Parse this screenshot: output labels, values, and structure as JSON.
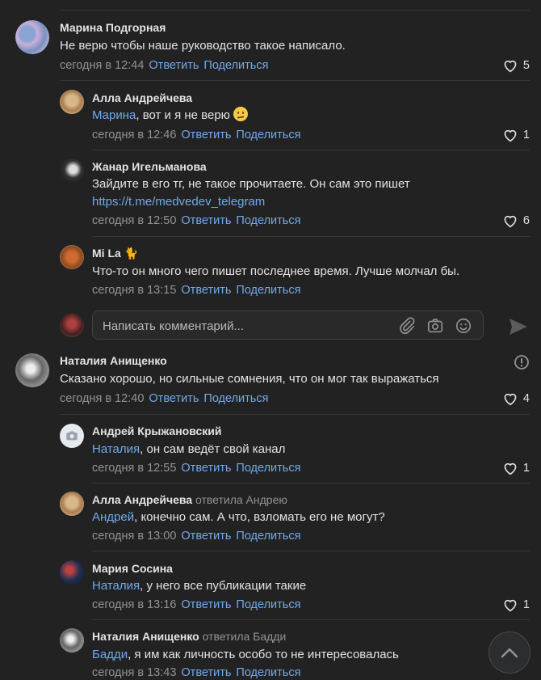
{
  "comments": [
    {
      "author": "Марина Подгорная",
      "replied": "",
      "text_link": "",
      "text": "Не верю чтобы наше руководство такое написало.",
      "url": "",
      "time": "сегодня в 12:44",
      "reply": "Ответить",
      "share": "Поделиться",
      "likes": "5"
    },
    {
      "author": "Алла Андрейчева",
      "replied": "",
      "text_link": "Марина",
      "text": ", вот и я не верю",
      "url": "",
      "time": "сегодня в 12:46",
      "reply": "Ответить",
      "share": "Поделиться",
      "likes": "1"
    },
    {
      "author": "Жанар Игельманова",
      "replied": "",
      "text_link": "",
      "text": "Зайдите в его тг, не такое прочитаете. Он сам это пишет",
      "url": "https://t.me/medvedev_telegram",
      "time": "сегодня в 12:50",
      "reply": "Ответить",
      "share": "Поделиться",
      "likes": "6"
    },
    {
      "author": "Mi La 🐈",
      "replied": "",
      "text_link": "",
      "text": "Что-то он много чего пишет последнее время. Лучше молчал бы.",
      "url": "",
      "time": "сегодня в 13:15",
      "reply": "Ответить",
      "share": "Поделиться",
      "likes": ""
    },
    {
      "author": "Наталия Анищенко",
      "replied": "",
      "text_link": "",
      "text": "Сказано хорошо, но сильные сомнения, что он мог так выражаться",
      "url": "",
      "time": "сегодня в 12:40",
      "reply": "Ответить",
      "share": "Поделиться",
      "likes": "4"
    },
    {
      "author": "Андрей Крыжановский",
      "replied": "",
      "text_link": "Наталия",
      "text": ", он сам ведёт свой канал",
      "url": "",
      "time": "сегодня в 12:55",
      "reply": "Ответить",
      "share": "Поделиться",
      "likes": "1"
    },
    {
      "author": "Алла Андрейчева",
      "replied": "ответила Андрею",
      "text_link": "Андрей",
      "text": ", конечно сам. А что, взломать его не могут?",
      "url": "",
      "time": "сегодня в 13:00",
      "reply": "Ответить",
      "share": "Поделиться",
      "likes": ""
    },
    {
      "author": "Мария Сосина",
      "replied": "",
      "text_link": "Наталия",
      "text": ", у него все публикации такие",
      "url": "",
      "time": "сегодня в 13:16",
      "reply": "Ответить",
      "share": "Поделиться",
      "likes": "1"
    },
    {
      "author": "Наталия Анищенко",
      "replied": "ответила Бадди",
      "text_link": "Бадди",
      "text": ", я им как личность особо то не интересовалась",
      "url": "",
      "time": "сегодня в 13:43",
      "reply": "Ответить",
      "share": "Поделиться",
      "likes": ""
    }
  ],
  "composer": {
    "placeholder": "Написать комментарий..."
  },
  "icons": {
    "attach": "paperclip-icon",
    "camera": "camera-icon",
    "emoji": "smile-icon",
    "send": "send-icon",
    "like": "heart-icon",
    "info": "info-icon",
    "scroll_up": "chevron-up-icon"
  },
  "colors": {
    "background": "#222222",
    "text": "#e1e3e6",
    "link": "#71aaeb",
    "muted": "#939393",
    "separator": "#363738"
  }
}
